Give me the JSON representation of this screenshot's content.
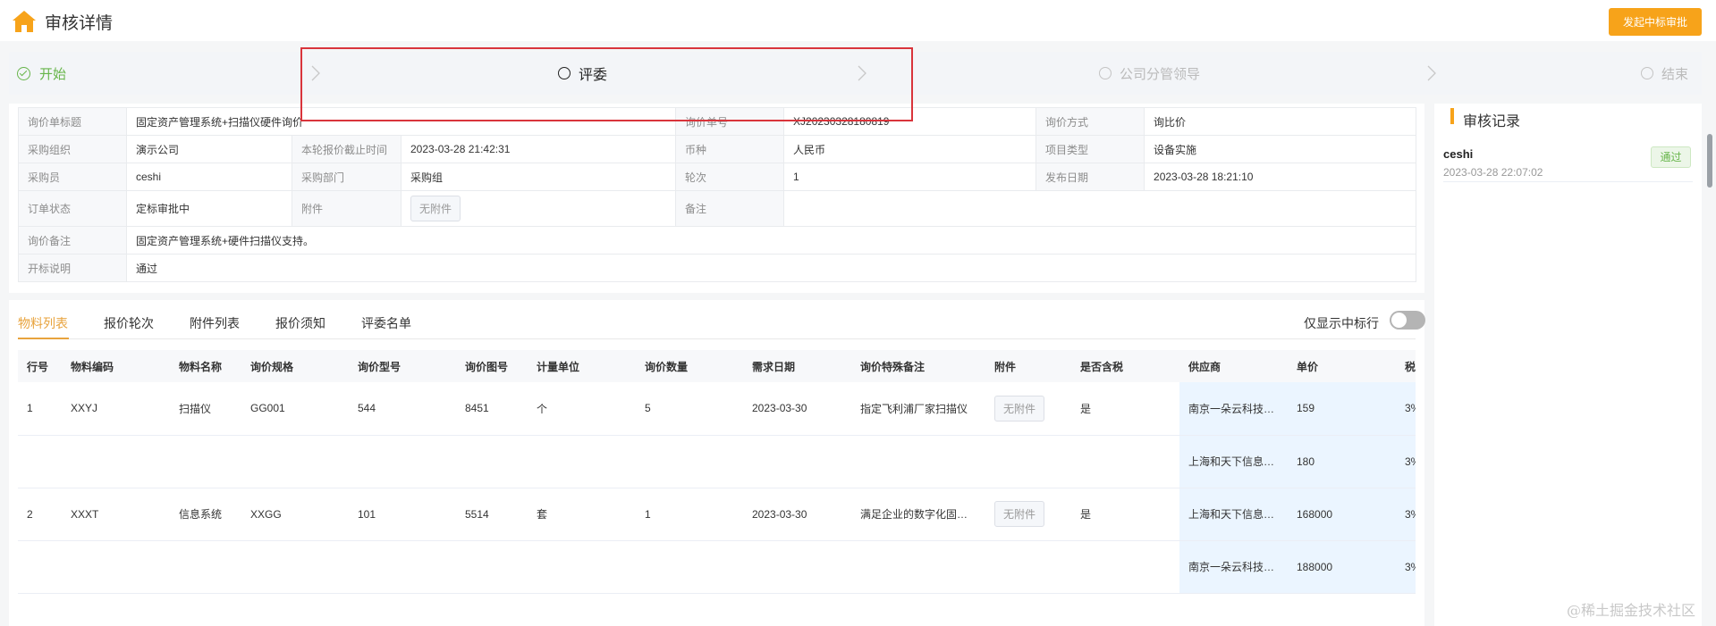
{
  "header": {
    "title": "审核详情",
    "approve_button": "发起中标审批",
    "home_icon": "home-icon",
    "accent_color": "#f7a31a"
  },
  "steps": [
    {
      "label": "开始",
      "state": "done"
    },
    {
      "label": "评委",
      "state": "active"
    },
    {
      "label": "公司分管领导",
      "state": "pending"
    },
    {
      "label": "结束",
      "state": "pending"
    }
  ],
  "info": {
    "inquiry_title_label": "询价单标题",
    "inquiry_title": "固定资产管理系统+扫描仪硬件询价",
    "inquiry_no_label": "询价单号",
    "inquiry_no": "XJ20230328180819",
    "inquiry_method_label": "询价方式",
    "inquiry_method": "询比价",
    "purchase_org_label": "采购组织",
    "purchase_org": "演示公司",
    "deadline_label": "本轮报价截止时间",
    "deadline": "2023-03-28 21:42:31",
    "currency_label": "币种",
    "currency": "人民币",
    "project_type_label": "项目类型",
    "project_type": "设备实施",
    "buyer_label": "采购员",
    "buyer": "ceshi",
    "dept_label": "采购部门",
    "dept": "采购组",
    "round_label": "轮次",
    "round": "1",
    "publish_date_label": "发布日期",
    "publish_date": "2023-03-28 18:21:10",
    "order_status_label": "订单状态",
    "order_status": "定标审批中",
    "attachment_label": "附件",
    "attachment_button": "无附件",
    "remark_label": "备注",
    "remark": "",
    "inquiry_remark_label": "询价备注",
    "inquiry_remark": "固定资产管理系统+硬件扫描仪支持。",
    "bid_desc_label": "开标说明",
    "bid_desc": "通过"
  },
  "tabs": [
    "物料列表",
    "报价轮次",
    "附件列表",
    "报价须知",
    "评委名单"
  ],
  "toggle": {
    "label": "仅显示中标行",
    "on": false
  },
  "grid": {
    "columns": [
      "行号",
      "物料编码",
      "物料名称",
      "询价规格",
      "询价型号",
      "询价图号",
      "计量单位",
      "询价数量",
      "需求日期",
      "询价特殊备注",
      "附件",
      "是否含税",
      "供应商",
      "单价",
      "税率"
    ],
    "rows": [
      [
        "1",
        "XXYJ",
        "扫描仪",
        "GG001",
        "544",
        "8451",
        "个",
        "5",
        "2023-03-30",
        "指定飞利浦厂家扫描仪",
        "无附件",
        "是",
        "南京一朵云科技有限公司",
        "159",
        "3%"
      ],
      [
        "",
        "",
        "",
        "",
        "",
        "",
        "",
        "",
        "",
        "",
        "",
        "",
        "上海和天下信息技术有限公司",
        "180",
        "3%"
      ],
      [
        "2",
        "XXXT",
        "信息系统",
        "XXGG",
        "101",
        "5514",
        "套",
        "1",
        "2023-03-30",
        "满足企业的数字化固定资产管理",
        "无附件",
        "是",
        "上海和天下信息技术有限公司",
        "168000",
        "3%"
      ],
      [
        "",
        "",
        "",
        "",
        "",
        "",
        "",
        "",
        "",
        "",
        "",
        "",
        "南京一朵云科技有限公司",
        "188000",
        "3%"
      ]
    ]
  },
  "review": {
    "title": "审核记录",
    "records": [
      {
        "name": "ceshi",
        "time": "2023-03-28 22:07:02",
        "result": "通过"
      }
    ]
  },
  "watermark": "@稀土掘金技术社区"
}
